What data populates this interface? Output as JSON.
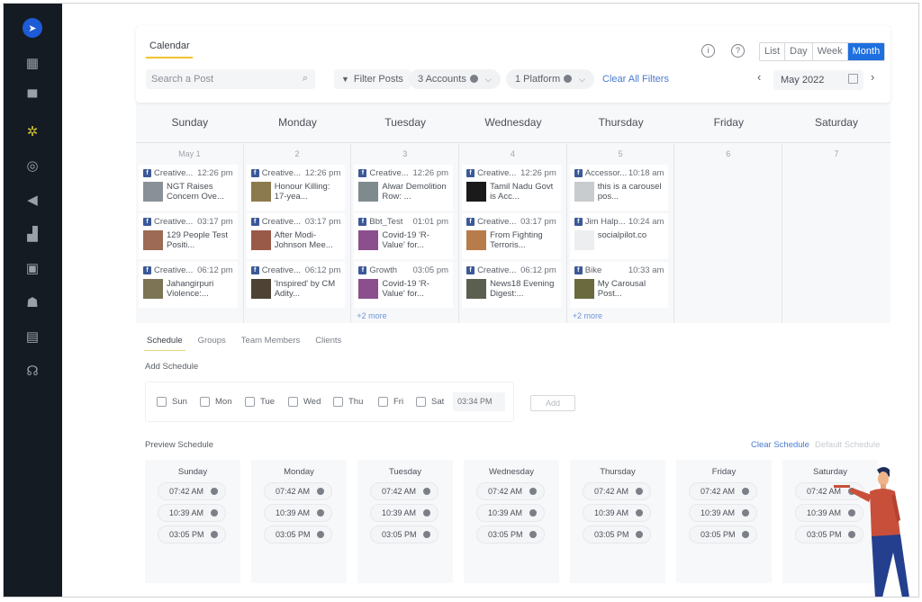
{
  "sidebar": {
    "items": [
      {
        "icon": "paper-plane-logo-icon",
        "glyph": "➤"
      },
      {
        "icon": "dashboard-icon",
        "glyph": "▦"
      },
      {
        "icon": "chat-icon",
        "glyph": "▀"
      },
      {
        "icon": "network-icon",
        "glyph": "✲"
      },
      {
        "icon": "target-icon",
        "glyph": "◎"
      },
      {
        "icon": "megaphone-icon",
        "glyph": "◀"
      },
      {
        "icon": "analytics-icon",
        "glyph": "▟"
      },
      {
        "icon": "inbox-icon",
        "glyph": "▣"
      },
      {
        "icon": "team-icon",
        "glyph": "☗"
      },
      {
        "icon": "document-icon",
        "glyph": "▤"
      },
      {
        "icon": "headset-icon",
        "glyph": "☊"
      }
    ],
    "active_index": 3
  },
  "toolbar": {
    "tab_label": "Calendar",
    "search_placeholder": "Search a Post",
    "filter_label": "Filter Posts",
    "accounts_chip": "3 Accounts",
    "platform_chip": "1 Platform",
    "clear_filters": "Clear All Filters",
    "info_glyph": "i",
    "help_glyph": "?",
    "views": [
      "List",
      "Day",
      "Week",
      "Month"
    ],
    "active_view": "Month",
    "month_value": "May 2022",
    "prev_glyph": "‹",
    "next_glyph": "›"
  },
  "colors": {
    "accent": "#1e6fe0",
    "tab_underline": "#f2c22e",
    "link": "#4b7bd1",
    "facebook": "#3b5998",
    "sidebar_bg": "#151b22"
  },
  "calendar": {
    "weekdays": [
      "Sunday",
      "Monday",
      "Tuesday",
      "Wednesday",
      "Thursday",
      "Friday",
      "Saturday"
    ],
    "days": [
      {
        "num": "May 1",
        "posts": [
          {
            "account": "Creative...",
            "time": "12:26 pm",
            "text": "NGT Raises Concern Ove...",
            "thumb": "#8a9098"
          },
          {
            "account": "Creative...",
            "time": "03:17 pm",
            "text": "129 People Test Positi...",
            "thumb": "#9c6a55"
          },
          {
            "account": "Creative...",
            "time": "06:12 pm",
            "text": "Jahangirpuri Violence:...",
            "thumb": "#7d7455"
          }
        ],
        "more": ""
      },
      {
        "num": "2",
        "posts": [
          {
            "account": "Creative...",
            "time": "12:26 pm",
            "text": "Honour Killing: 17-yea...",
            "thumb": "#8b7a4e"
          },
          {
            "account": "Creative...",
            "time": "03:17 pm",
            "text": "After Modi-Johnson Mee...",
            "thumb": "#9a5a48"
          },
          {
            "account": "Creative...",
            "time": "06:12 pm",
            "text": "'Inspired' by CM Adity...",
            "thumb": "#4d4234"
          }
        ],
        "more": ""
      },
      {
        "num": "3",
        "posts": [
          {
            "account": "Creative...",
            "time": "12:26 pm",
            "text": "Alwar Demolition Row: ...",
            "thumb": "#7f8a8e"
          },
          {
            "account": "Bbt_Test",
            "time": "01:01 pm",
            "text": "Covid-19 'R-Value' for...",
            "thumb": "#8a4f8c"
          },
          {
            "account": "Growth",
            "time": "03:05 pm",
            "text": "Covid-19 'R-Value' for...",
            "thumb": "#8a4f8c"
          }
        ],
        "more": "+2 more"
      },
      {
        "num": "4",
        "posts": [
          {
            "account": "Creative...",
            "time": "12:26 pm",
            "text": "Tamil Nadu Govt is Acc...",
            "thumb": "#1a1a1a"
          },
          {
            "account": "Creative...",
            "time": "03:17 pm",
            "text": "From Fighting Terroris...",
            "thumb": "#b87b4a"
          },
          {
            "account": "Creative...",
            "time": "06:12 pm",
            "text": "News18 Evening Digest:...",
            "thumb": "#5a5f50"
          }
        ],
        "more": ""
      },
      {
        "num": "5",
        "posts": [
          {
            "account": "Accessor...",
            "time": "10:18 am",
            "text": "this is a carousel pos...",
            "thumb": "#c9cccf"
          },
          {
            "account": "Jim Halp...",
            "time": "10:24 am",
            "text": "socialpilot.co",
            "thumb": "#eceef0"
          },
          {
            "account": "Bike",
            "time": "10:33 am",
            "text": "My Carousal Post...",
            "thumb": "#6b6a3e"
          }
        ],
        "more": "+2 more"
      },
      {
        "num": "6",
        "posts": [],
        "more": ""
      },
      {
        "num": "7",
        "posts": [],
        "more": ""
      }
    ]
  },
  "schedule": {
    "tabs": [
      "Schedule",
      "Groups",
      "Team Members",
      "Clients"
    ],
    "active_tab": "Schedule",
    "add_title": "Add Schedule",
    "day_checks": [
      "Sun",
      "Mon",
      "Tue",
      "Wed",
      "Thu",
      "Fri",
      "Sat"
    ],
    "time_value": "03:34 PM",
    "add_label": "Add",
    "preview_title": "Preview Schedule",
    "clear_label": "Clear Schedule",
    "default_label": "Default Schedule",
    "preview": [
      {
        "day": "Sunday",
        "times": [
          "07:42 AM",
          "10:39 AM",
          "03:05 PM"
        ]
      },
      {
        "day": "Monday",
        "times": [
          "07:42 AM",
          "10:39 AM",
          "03:05 PM"
        ]
      },
      {
        "day": "Tuesday",
        "times": [
          "07:42 AM",
          "10:39 AM",
          "03:05 PM"
        ]
      },
      {
        "day": "Wednesday",
        "times": [
          "07:42 AM",
          "10:39 AM",
          "03:05 PM"
        ]
      },
      {
        "day": "Thursday",
        "times": [
          "07:42 AM",
          "10:39 AM",
          "03:05 PM"
        ]
      },
      {
        "day": "Friday",
        "times": [
          "07:42 AM",
          "10:39 AM",
          "03:05 PM"
        ]
      },
      {
        "day": "Saturday",
        "times": [
          "07:42 AM",
          "10:39 AM",
          "03:05 PM"
        ]
      }
    ]
  }
}
